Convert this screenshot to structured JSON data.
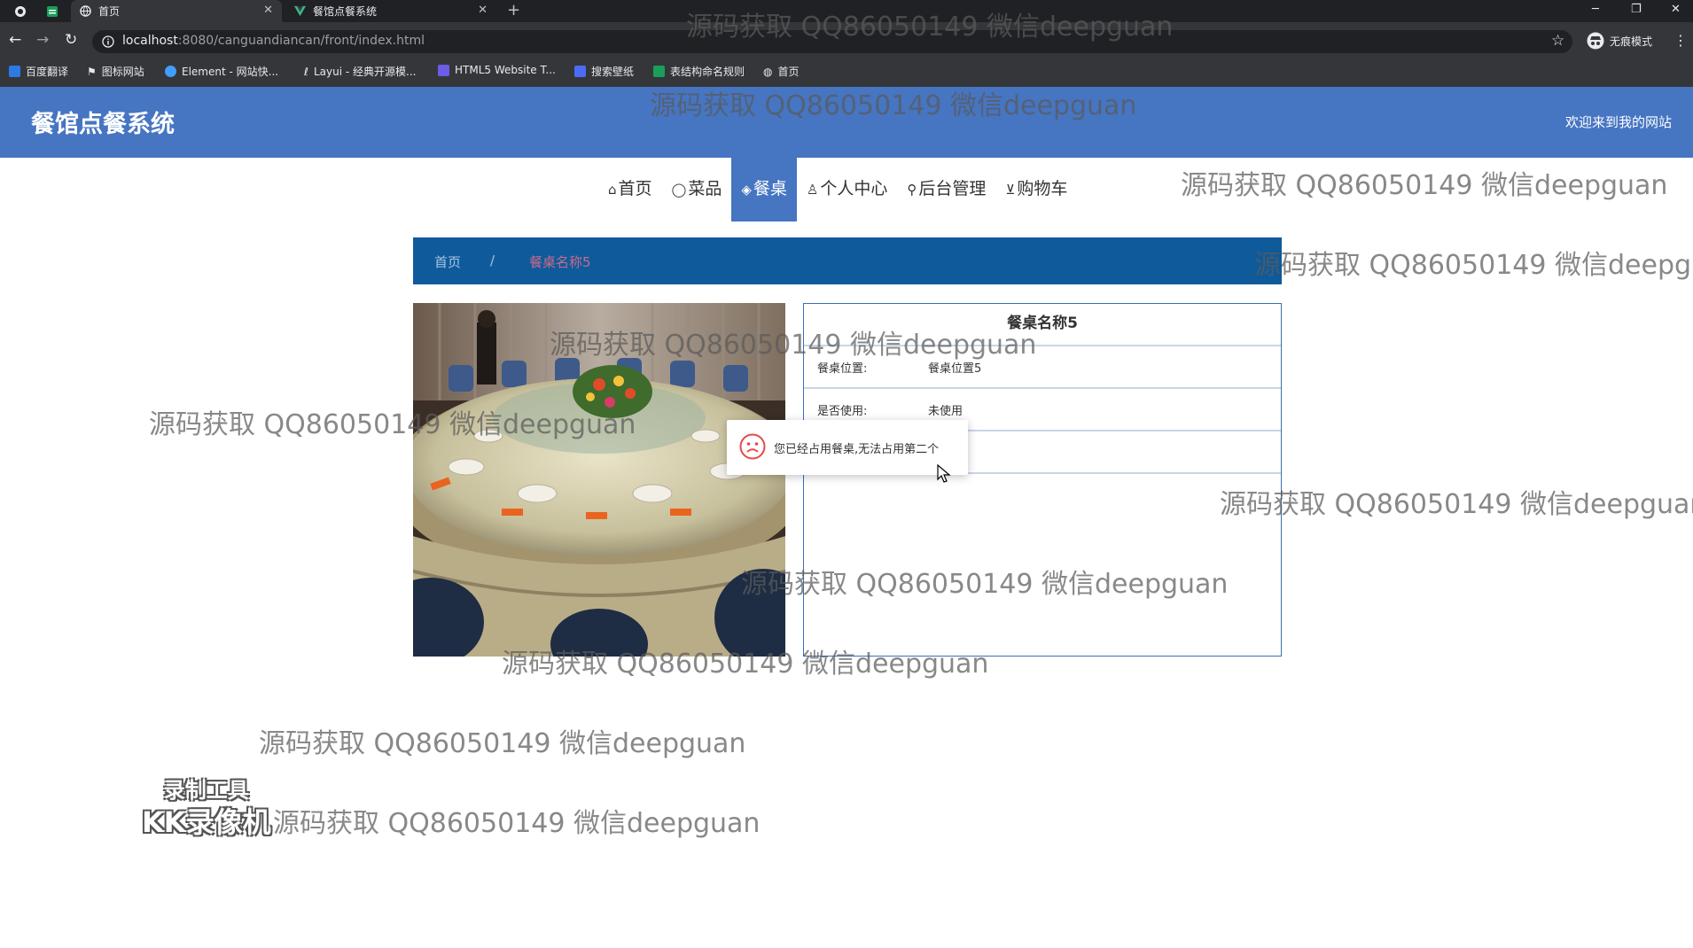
{
  "browser": {
    "tabs": [
      {
        "title": "首页",
        "active": true
      },
      {
        "title": "餐馆点餐系统",
        "active": false
      }
    ],
    "url_host": "localhost",
    "url_rest": ":8080/canguandiancan/front/index.html",
    "incognito_label": "无痕模式",
    "bookmarks": [
      {
        "label": "百度翻译",
        "color": "#2b7be4"
      },
      {
        "label": "图标网站",
        "color": "#ffffff"
      },
      {
        "label": "Element - 网站快...",
        "color": "#409eff"
      },
      {
        "label": "Layui - 经典开源模...",
        "color": "#e8eaed"
      },
      {
        "label": "HTML5 Website T...",
        "color": "#6c5ce7"
      },
      {
        "label": "搜索壁纸",
        "color": "#4a6cf7"
      },
      {
        "label": "表结构命名规则",
        "color": "#18a058"
      },
      {
        "label": "首页",
        "color": "#e8eaed"
      }
    ]
  },
  "site": {
    "title": "餐馆点餐系统",
    "welcome": "欢迎来到我的网站",
    "header_color": "#4675c2",
    "nav": [
      {
        "icon": "⌂",
        "label": "首页",
        "active": false
      },
      {
        "icon": "◯",
        "label": "菜品",
        "active": false
      },
      {
        "icon": "◈",
        "label": "餐桌",
        "active": true
      },
      {
        "icon": "♙",
        "label": "个人中心",
        "active": false
      },
      {
        "icon": "⚲",
        "label": "后台管理",
        "active": false
      },
      {
        "icon": "⊻",
        "label": "购物车",
        "active": false
      }
    ]
  },
  "breadcrumb": {
    "home": "首页",
    "separator": "/",
    "current": "餐桌名称5"
  },
  "detail": {
    "title": "餐桌名称5",
    "rows": [
      {
        "key": "餐桌位置:",
        "value": "餐桌位置5"
      },
      {
        "key": "是否使用:",
        "value": "未使用"
      }
    ]
  },
  "toast": {
    "icon": "sad-face-icon",
    "message": "您已经占用餐桌,无法占用第二个"
  },
  "watermark_text": "源码获取 QQ86050149 微信deepguan",
  "recorder": {
    "line1": "录制工具",
    "line2": "KK录像机"
  }
}
